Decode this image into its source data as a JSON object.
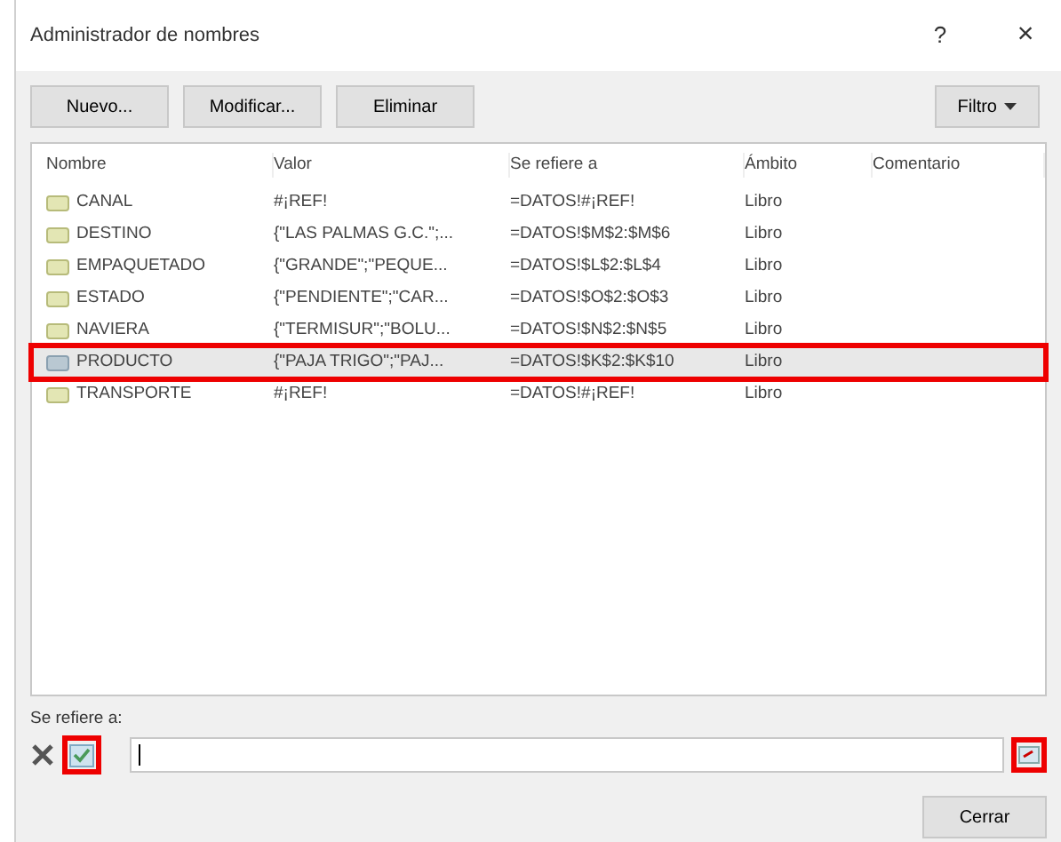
{
  "window": {
    "title": "Administrador de nombres",
    "help": "?",
    "close": "×"
  },
  "toolbar": {
    "buttons": [
      "Nuevo...",
      "Modificar...",
      "Eliminar"
    ],
    "filter": "Filtro"
  },
  "table": {
    "columns": [
      "Nombre",
      "Valor",
      "Se refiere a",
      "Ámbito",
      "Comentario"
    ],
    "rows": [
      {
        "name": "CANAL",
        "value": "#¡REF!",
        "refers_to": "=DATOS!#¡REF!",
        "scope": "Libro",
        "selected": false,
        "outlined": false
      },
      {
        "name": "DESTINO",
        "value": "{\"LAS PALMAS G.C.\";...",
        "refers_to": "=DATOS!$M$2:$M$6",
        "scope": "Libro",
        "selected": false,
        "outlined": false
      },
      {
        "name": "EMPAQUETADO",
        "value": "{\"GRANDE\";\"PEQUE...",
        "refers_to": "=DATOS!$L$2:$L$4",
        "scope": "Libro",
        "selected": false,
        "outlined": false
      },
      {
        "name": "ESTADO",
        "value": "{\"PENDIENTE\";\"CAR...",
        "refers_to": "=DATOS!$O$2:$O$3",
        "scope": "Libro",
        "selected": false,
        "outlined": false
      },
      {
        "name": "NAVIERA",
        "value": "{\"TERMISUR\";\"BOLU...",
        "refers_to": "=DATOS!$N$2:$N$5",
        "scope": "Libro",
        "selected": false,
        "outlined": false
      },
      {
        "name": "PRODUCTO",
        "value": "{\"PAJA TRIGO\";\"PAJ...",
        "refers_to": "=DATOS!$K$2:$K$10",
        "scope": "Libro",
        "selected": true,
        "outlined": true
      },
      {
        "name": "TRANSPORTE",
        "value": "#¡REF!",
        "refers_to": "=DATOS!#¡REF!",
        "scope": "Libro",
        "selected": false,
        "outlined": false
      }
    ]
  },
  "refers_to": {
    "label": "Se refiere a:",
    "confirm_outlined": true,
    "collapse_outlined": true
  },
  "close_button": "Cerrar"
}
